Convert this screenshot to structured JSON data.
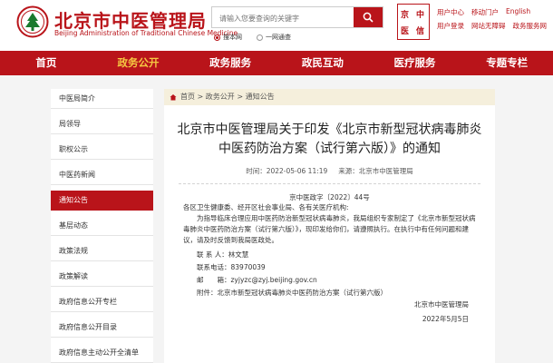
{
  "header": {
    "title": "北京市中医管理局",
    "subtitle": "Beijing Administration of Traditional Chinese Medicine",
    "search_placeholder": "请输入您要查询的关键字",
    "radio_site": "搜本网",
    "radio_all": "一网通查",
    "app_chars": [
      "京",
      "中",
      "医",
      "信"
    ],
    "links_row1": [
      "用户中心",
      "移动门户",
      "English"
    ],
    "links_row2": [
      "用户登录",
      "网站无障碍",
      "政务服务网"
    ]
  },
  "nav": {
    "items": [
      "首页",
      "政务公开",
      "政务服务",
      "政民互动",
      "医疗服务",
      "专题专栏"
    ],
    "active_index": 1
  },
  "sidebar": {
    "items": [
      "中医局简介",
      "局领导",
      "职权公示",
      "中医药新闻",
      "通知公告",
      "基层动态",
      "政策法规",
      "政策解读",
      "政府信息公开专栏",
      "政府信息公开目录",
      "政府信息主动公开全清单"
    ],
    "active_index": 4
  },
  "breadcrumb": {
    "text": "首页 > 政务公开 > 通知公告"
  },
  "article": {
    "title": "北京市中医管理局关于印发《北京市新型冠状病毒肺炎中医药防治方案（试行第六版）》的通知",
    "time": "时间：2022-05-06 11:19",
    "source": "来源：北京市中医管理局",
    "doc_no": "京中医政字〔2022〕44号",
    "addressee": "各区卫生健康委、经开区社会事业局、各有关医疗机构:",
    "paragraph": "为指导临床合理应用中医药防治新型冠状病毒肺炎，我局组织专家制定了《北京市新型冠状病毒肺炎中医药防治方案（试行第六版）》，现印发给你们，请遵照执行。在执行中有任何问题和建议，请及时反馈到我局医政处。",
    "contact_person": "联 系 人：林文慧",
    "contact_phone": "联系电话：83970039",
    "contact_email": "邮　　箱：zyjyzc@zyj.beijing.gov.cn",
    "attachment": "附件：北京市新型冠状病毒肺炎中医药防治方案（试行第六版）",
    "signature": "北京市中医管理局",
    "date": "2022年5月5日"
  },
  "colors": {
    "brand_red": "#b9141a",
    "nav_active": "#f5c842",
    "breadcrumb_bg": "#f5efdc"
  }
}
